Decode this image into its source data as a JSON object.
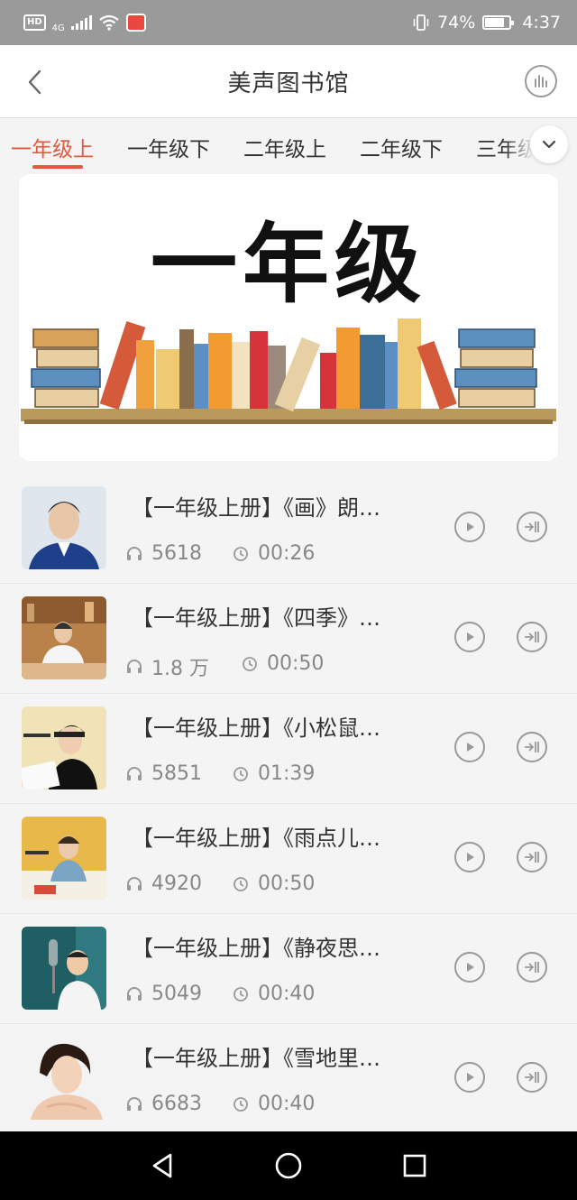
{
  "status_bar": {
    "hd": "HD",
    "network": "4G",
    "battery": "74%",
    "time": "4:37"
  },
  "header": {
    "title": "美声图书馆"
  },
  "tabs": [
    {
      "label": "一年级上",
      "active": true
    },
    {
      "label": "一年级下",
      "active": false
    },
    {
      "label": "二年级上",
      "active": false
    },
    {
      "label": "二年级下",
      "active": false
    },
    {
      "label": "三年级上",
      "active": false
    }
  ],
  "banner": {
    "title": "一年级"
  },
  "items": [
    {
      "title": "【一年级上册】《画》朗…",
      "plays": "5618",
      "duration": "00:26"
    },
    {
      "title": "【一年级上册】《四季》…",
      "plays": "1.8 万",
      "duration": "00:50"
    },
    {
      "title": "【一年级上册】《小松鼠…",
      "plays": "5851",
      "duration": "01:39"
    },
    {
      "title": "【一年级上册】《雨点儿…",
      "plays": "4920",
      "duration": "00:50"
    },
    {
      "title": "【一年级上册】《静夜思…",
      "plays": "5049",
      "duration": "00:40"
    },
    {
      "title": "【一年级上册】《雪地里…",
      "plays": "6683",
      "duration": "00:40"
    }
  ],
  "colors": {
    "accent": "#e4583e",
    "status_bar": "#9a9a9a",
    "background": "#f4f4f4"
  }
}
